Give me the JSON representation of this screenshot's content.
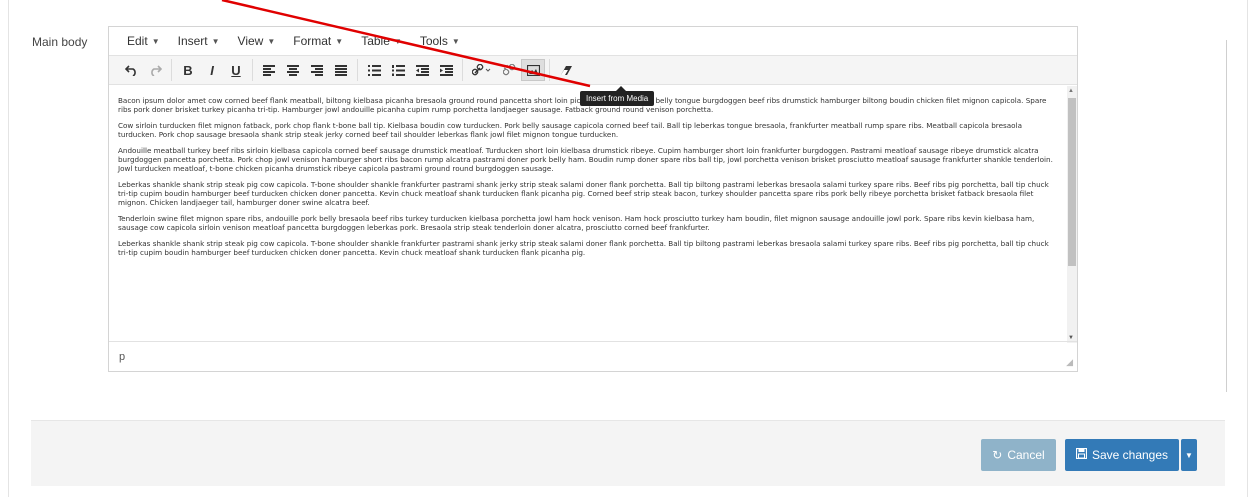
{
  "field": {
    "label": "Main body"
  },
  "menubar": {
    "items": [
      {
        "label": "Edit"
      },
      {
        "label": "Insert"
      },
      {
        "label": "View"
      },
      {
        "label": "Format"
      },
      {
        "label": "Table"
      },
      {
        "label": "Tools"
      }
    ]
  },
  "toolbar": {
    "tooltip": "Insert from Media",
    "icons": [
      "undo-icon",
      "redo-icon",
      "bold-icon",
      "italic-icon",
      "underline-icon",
      "align-left-icon",
      "align-center-icon",
      "align-right-icon",
      "align-justify-icon",
      "bullet-list-icon",
      "numbered-list-icon",
      "outdent-icon",
      "indent-icon",
      "link-icon",
      "unlink-icon",
      "insert-media-icon",
      "clear-formatting-icon"
    ],
    "bold_glyph": "B",
    "italic_glyph": "I",
    "underline_glyph": "U"
  },
  "content": {
    "paragraphs": [
      "Bacon ipsum dolor amet cow corned beef flank meatball, biltong kielbasa picanha bresaola ground round pancetta short loin picanha jerky jowl pork belly tongue burgdoggen beef ribs drumstick hamburger biltong boudin chicken filet mignon capicola. Spare ribs pork doner brisket turkey picanha tri-tip. Hamburger jowl andouille picanha cupim rump porchetta landjaeger sausage. Fatback ground round venison porchetta.",
      "Cow sirloin turducken filet mignon fatback, pork chop flank t-bone ball tip. Kielbasa boudin cow turducken. Pork belly sausage capicola corned beef tail. Ball tip leberkas tongue bresaola, frankfurter meatball rump spare ribs. Meatball capicola bresaola turducken. Pork chop sausage bresaola shank strip steak jerky corned beef tail shoulder leberkas flank jowl filet mignon tongue turducken.",
      "Andouille meatball turkey beef ribs sirloin kielbasa capicola corned beef sausage drumstick meatloaf. Turducken short loin kielbasa drumstick ribeye. Cupim hamburger short loin frankfurter burgdoggen. Pastrami meatloaf sausage ribeye drumstick alcatra burgdoggen pancetta porchetta. Pork chop jowl venison hamburger short ribs bacon rump alcatra pastrami doner pork belly ham. Boudin rump doner spare ribs ball tip, jowl porchetta venison brisket prosciutto meatloaf sausage frankfurter shankle tenderloin. Jowl turducken meatloaf, t-bone chicken picanha drumstick ribeye capicola pastrami ground round burgdoggen sausage.",
      "Leberkas shankle shank strip steak pig cow capicola. T-bone shoulder shankle frankfurter pastrami shank jerky strip steak salami doner flank porchetta. Ball tip biltong pastrami leberkas bresaola salami turkey spare ribs. Beef ribs pig porchetta, ball tip chuck tri-tip cupim boudin hamburger beef turducken chicken doner pancetta. Kevin chuck meatloaf shank turducken flank picanha pig. Corned beef strip steak bacon, turkey shoulder pancetta spare ribs pork belly ribeye porchetta brisket fatback bresaola filet mignon. Chicken landjaeger tail, hamburger doner swine alcatra beef.",
      "Tenderloin swine filet mignon spare ribs, andouille pork belly bresaola beef ribs turkey turducken kielbasa porchetta jowl ham hock venison. Ham hock prosciutto turkey ham boudin, filet mignon sausage andouille jowl pork. Spare ribs kevin kielbasa ham, sausage cow capicola sirloin venison meatloaf pancetta burgdoggen leberkas pork. Bresaola strip steak tenderloin doner alcatra, prosciutto corned beef frankfurter.",
      "Leberkas shankle shank strip steak pig cow capicola. T-bone shoulder shankle frankfurter pastrami shank jerky strip steak salami doner flank porchetta. Ball tip biltong pastrami leberkas bresaola salami turkey spare ribs. Beef ribs pig porchetta, ball tip chuck tri-tip cupim boudin hamburger beef turducken chicken doner pancetta. Kevin chuck meatloaf shank turducken flank picanha pig."
    ]
  },
  "statusbar": {
    "path": "p"
  },
  "footer": {
    "cancel_label": "Cancel",
    "save_label": "Save changes"
  },
  "colors": {
    "primary": "#337ab7",
    "cancel_disabled": "#8fb3c9",
    "annotation_arrow": "#e00000"
  }
}
